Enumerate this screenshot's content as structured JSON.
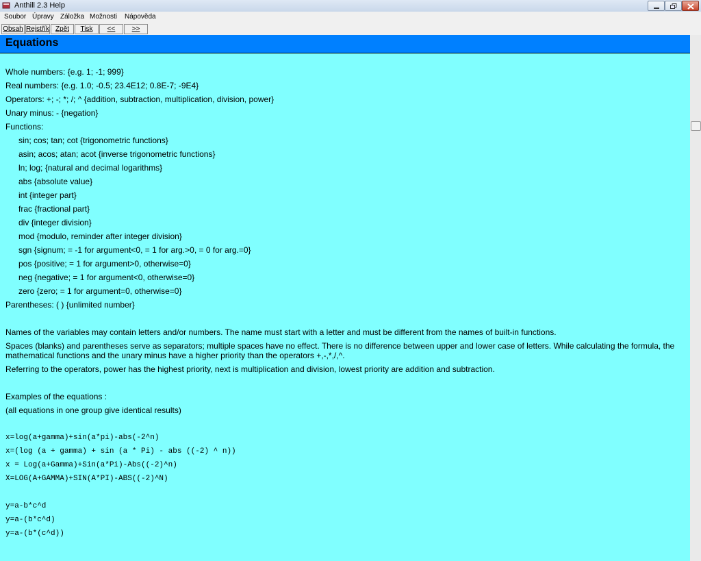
{
  "window": {
    "title": "Anthill 2.3 Help"
  },
  "menu": [
    "Soubor",
    "Úpravy",
    "Záložka",
    "Možnosti",
    "Nápověda"
  ],
  "toolbar": [
    "Obsah",
    "Rejstřík",
    "Zpět",
    "Tisk",
    "<<",
    ">>"
  ],
  "page": {
    "title": "Equations",
    "whole": "Whole numbers: {e.g. 1; -1; 999}",
    "real": "Real numbers: {e.g. 1.0; -0.5; 23.4E12; 0.8E-7; -9E4}",
    "operators": "Operators: +; -; *; /; ^ {addition, subtraction, multiplication, division, power}",
    "unary": "Unary minus: - {negation}",
    "functions_label": "Functions:",
    "functions": [
      "sin; cos; tan; cot {trigonometric functions}",
      "asin; acos; atan; acot {inverse trigonometric functions}",
      "ln; log; {natural and decimal logarithms}",
      "abs {absolute value}",
      "int {integer part}",
      "frac {fractional part}",
      "div {integer division}",
      "mod {modulo, reminder after integer division}",
      "sgn {signum; = -1 for argument<0, = 1 for arg.>0, = 0 for arg.=0}",
      "pos {positive; = 1 for argument>0, otherwise=0}",
      "neg {negative; = 1 for argument<0, otherwise=0}",
      "zero {zero; = 1 for argument=0, otherwise=0}"
    ],
    "parentheses": "Parentheses: ( ) {unlimited number}",
    "names_para": "Names of the variables may contain letters and/or numbers. The name must start with a letter and must be different from the names of built-in functions.",
    "spaces_para_1": "Spaces (blanks) and parentheses serve as separators; multiple spaces have no effect. There is no difference between upper and lower case of letters. While calculating the formula, the",
    "spaces_para_2": "mathematical functions and the unary minus have a higher priority than the operators +,-,*,/,^.",
    "priority_para": "Referring to the operators, power has the highest priority, next is multiplication and division, lowest priority are addition and subtraction.",
    "examples_title": "Examples of the equations :",
    "examples_note": "(all equations in one group give identical results)",
    "group1": [
      "x=log(a+gamma)+sin(a*pi)-abs(-2^n)",
      "x=(log (a + gamma) + sin (a * Pi) - abs ((-2) ^ n))",
      "x = Log(a+Gamma)+Sin(a*Pi)-Abs((-2)^n)",
      "X=LOG(A+GAMMA)+SIN(A*PI)-ABS((-2)^N)"
    ],
    "group2": [
      "y=a-b*c^d",
      "y=a-(b*c^d)",
      "y=a-(b*(c^d))"
    ]
  }
}
